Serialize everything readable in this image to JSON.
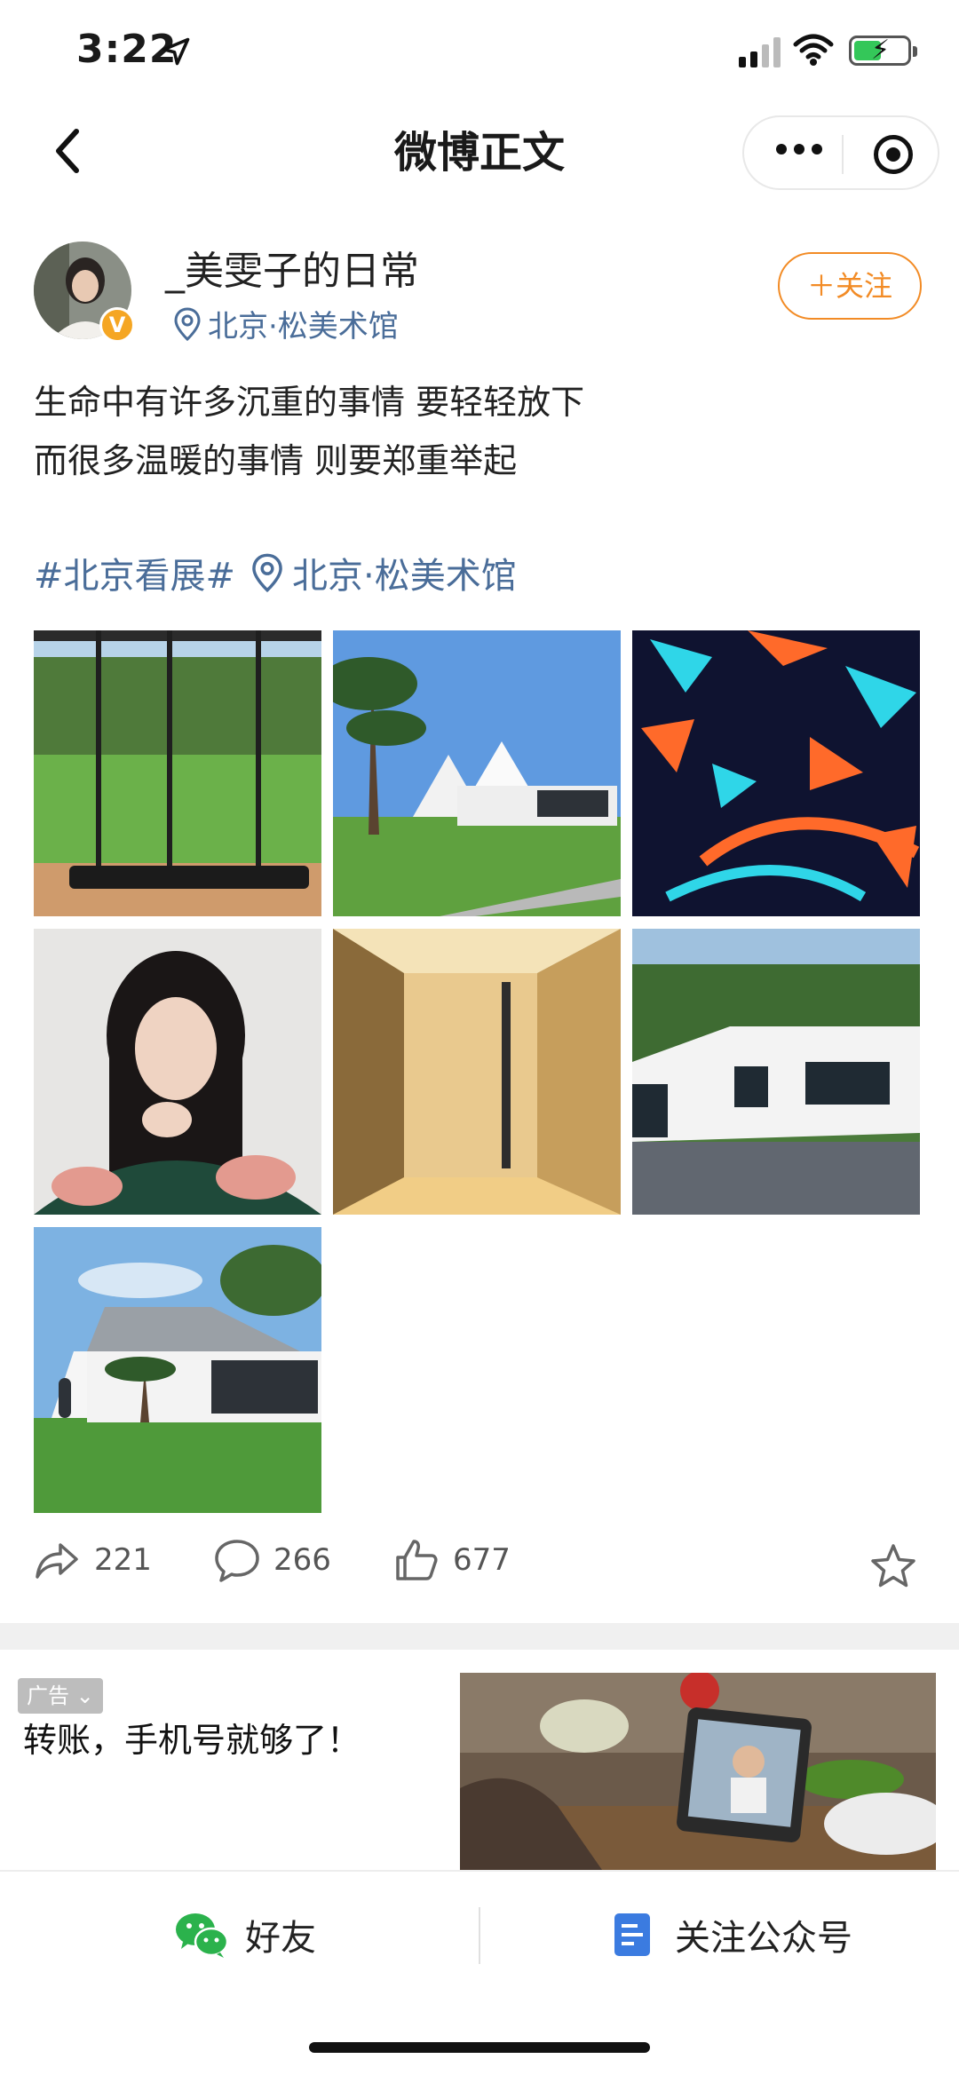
{
  "status_bar": {
    "time": "3:22"
  },
  "nav": {
    "title": "微博正文"
  },
  "post": {
    "username": "_美雯子的日常",
    "location": "北京·松美术馆",
    "follow_label": "＋关注",
    "text_lines": [
      "生命中有许多沉重的事情 要轻轻放下",
      "而很多温暖的事情 则要郑重举起"
    ],
    "hashtag": "#北京看展#",
    "tag_location": "北京·松美术馆",
    "images": [
      {
        "icon": "gallery-window-photo"
      },
      {
        "icon": "white-building-pine-photo"
      },
      {
        "icon": "neon-art-photo"
      },
      {
        "icon": "portrait-photo"
      },
      {
        "icon": "corridor-photo"
      },
      {
        "icon": "white-house-photo"
      },
      {
        "icon": "building-lawn-photo"
      }
    ],
    "repost_count": "221",
    "comment_count": "266",
    "like_count": "677"
  },
  "ad": {
    "tag": "广告",
    "text": "转账，手机号就够了！"
  },
  "bottom_bar": {
    "friends_label": "好友",
    "follow_account_label": "关注公众号"
  },
  "colors": {
    "link_blue": "#4a6d99",
    "follow_orange": "#f28b25",
    "verified_gold": "#f5a623"
  }
}
